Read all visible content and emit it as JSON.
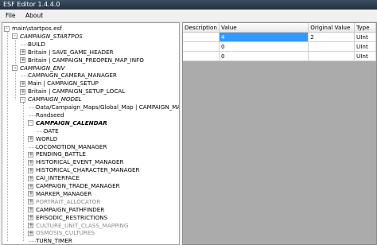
{
  "window": {
    "title": "ESF Editor 1.4.4.0"
  },
  "menu": {
    "file": "File",
    "about": "About"
  },
  "tree": {
    "nodes": [
      {
        "label": "main\\startpos.esf",
        "expander": "-",
        "style": ""
      },
      {
        "label": "CAMPAIGN_STARTPOS",
        "expander": "-",
        "style": "ital"
      },
      {
        "label": "BUILD",
        "expander": "",
        "style": ""
      },
      {
        "label": "Britain | SAVE_GAME_HEADER",
        "expander": "+",
        "style": ""
      },
      {
        "label": "Britain | CAMPAIGN_PREOPEN_MAP_INFO",
        "expander": "+",
        "style": ""
      },
      {
        "label": "CAMPAIGN_ENV",
        "expander": "-",
        "style": "ital"
      },
      {
        "label": "CAMPAIGN_CAMERA_MANAGER",
        "expander": "",
        "style": ""
      },
      {
        "label": "Main | CAMPAIGN_SETUP",
        "expander": "+",
        "style": ""
      },
      {
        "label": "Britain | CAMPAIGN_SETUP_LOCAL",
        "expander": "+",
        "style": ""
      },
      {
        "label": "CAMPAIGN_MODEL",
        "expander": "-",
        "style": "ital"
      },
      {
        "label": "Data/Campaign_Maps/Global_Map | CAMPAIGN_MAP_",
        "expander": "",
        "style": ""
      },
      {
        "label": "Randseed",
        "expander": "",
        "style": ""
      },
      {
        "label": "CAMPAIGN_CALENDAR",
        "expander": "-",
        "style": "sel"
      },
      {
        "label": "DATE",
        "expander": "",
        "style": ""
      },
      {
        "label": "WORLD",
        "expander": "+",
        "style": ""
      },
      {
        "label": "LOCOMOTION_MANAGER",
        "expander": "",
        "style": ""
      },
      {
        "label": "PENDING_BATTLE",
        "expander": "+",
        "style": ""
      },
      {
        "label": "HISTORICAL_EVENT_MANAGER",
        "expander": "+",
        "style": ""
      },
      {
        "label": "HISTORICAL_CHARACTER_MANAGER",
        "expander": "+",
        "style": ""
      },
      {
        "label": "CAI_INTERFACE",
        "expander": "+",
        "style": ""
      },
      {
        "label": "CAMPAIGN_TRADE_MANAGER",
        "expander": "+",
        "style": ""
      },
      {
        "label": "MARKER_MANAGER",
        "expander": "+",
        "style": ""
      },
      {
        "label": "PORTRAIT_ALLOCATOR",
        "expander": "+",
        "style": "gray"
      },
      {
        "label": "CAMPAIGN_PATHFINDER",
        "expander": "+",
        "style": ""
      },
      {
        "label": "EPISODIC_RESTRICTIONS",
        "expander": "+",
        "style": ""
      },
      {
        "label": "CULTURE_UNIT_CLASS_MAPPING",
        "expander": "+",
        "style": "gray"
      },
      {
        "label": "OSMOSIS_CULTURES",
        "expander": "+",
        "style": "gray"
      },
      {
        "label": "TURN_TIMER",
        "expander": "",
        "style": ""
      }
    ]
  },
  "grid": {
    "columns": [
      "Description",
      "Value",
      "Original Value",
      "Type"
    ],
    "rows": [
      {
        "description": "",
        "value": "4",
        "original": "2",
        "type": "UInt",
        "active": true
      },
      {
        "description": "",
        "value": "0",
        "original": "",
        "type": "UInt",
        "active": false
      },
      {
        "description": "",
        "value": "0",
        "original": "",
        "type": "UInt",
        "active": false
      }
    ]
  }
}
